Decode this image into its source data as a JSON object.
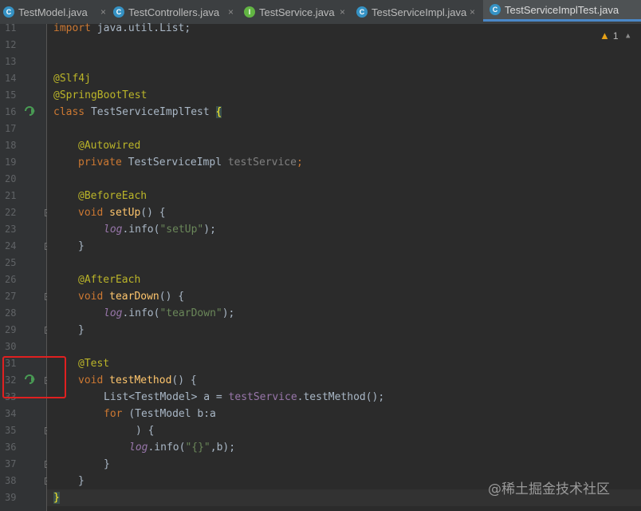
{
  "tabs": [
    {
      "label": "TestModel.java",
      "icon": "class-icon",
      "type": "c"
    },
    {
      "label": "TestControllers.java",
      "icon": "class-icon",
      "type": "c"
    },
    {
      "label": "TestService.java",
      "icon": "interface-icon",
      "type": "i"
    },
    {
      "label": "TestServiceImpl.java",
      "icon": "class-icon",
      "type": "c"
    },
    {
      "label": "TestServiceImplTest.java",
      "icon": "class-icon",
      "type": "c",
      "active": true
    }
  ],
  "tab_icon_letters": {
    "c": "C",
    "i": "I"
  },
  "close_glyph": "×",
  "warnings": {
    "icon": "warning-triangle-icon",
    "count": "1"
  },
  "watermark": "@稀土掘金技术社区",
  "line_numbers": [
    "11",
    "12",
    "13",
    "14",
    "15",
    "16",
    "17",
    "18",
    "19",
    "20",
    "21",
    "22",
    "23",
    "24",
    "25",
    "26",
    "27",
    "28",
    "29",
    "30",
    "31",
    "32",
    "33",
    "34",
    "35",
    "36",
    "37",
    "38",
    "39"
  ],
  "code": {
    "l11_a": "import ",
    "l11_b": "java.util.List;",
    "l14": "@Slf4j",
    "l15": "@SpringBootTest",
    "l16_kw": "class ",
    "l16_name": "TestServiceImplTest ",
    "l16_brace": "{",
    "l18": "@Autowired",
    "l19_kw": "private ",
    "l19_type": "TestServiceImpl ",
    "l19_var": "testService",
    "l19_semi": ";",
    "l21": "@BeforeEach",
    "l22_kw": "void ",
    "l22_fn": "setUp",
    "l22_rest": "() {",
    "l23_log": "log",
    "l23_mid": ".info(",
    "l23_str": "\"setUp\"",
    "l23_end": ");",
    "l24": "}",
    "l26": "@AfterEach",
    "l27_kw": "void ",
    "l27_fn": "tearDown",
    "l27_rest": "() {",
    "l28_log": "log",
    "l28_mid": ".info(",
    "l28_str": "\"tearDown\"",
    "l28_end": ");",
    "l29": "}",
    "l31": "@Test",
    "l32_kw": "void ",
    "l32_fn": "testMethod",
    "l32_rest": "() {",
    "l33_a": "List<TestModel> a = ",
    "l33_field": "testService",
    "l33_end": ".testMethod();",
    "l34_kw": "for ",
    "l34_rest": "(TestModel b:a",
    "l35": ") {",
    "l36_log": "log",
    "l36_mid": ".info(",
    "l36_str": "\"{}\"",
    "l36_end": ",b);",
    "l37": "}",
    "l38": "}",
    "l39": "}"
  },
  "colors": {
    "keyword": "#cc7832",
    "annotation": "#bbb529",
    "string": "#6a8759",
    "method": "#ffc66d",
    "field": "#9876aa",
    "highlight_box": "#e02020"
  }
}
